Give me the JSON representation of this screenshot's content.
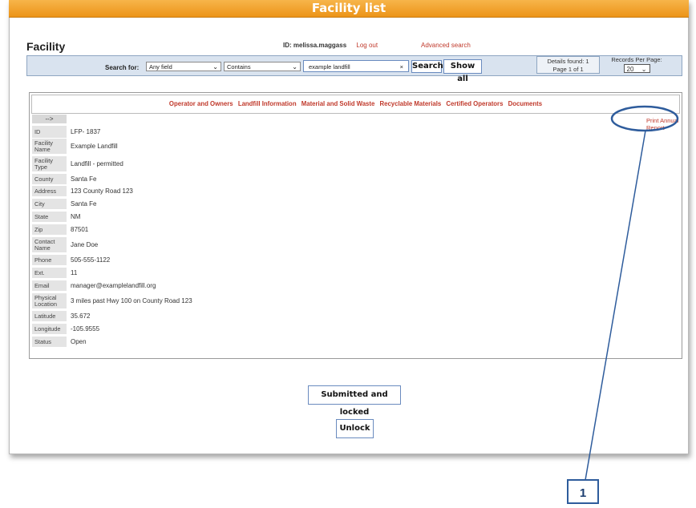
{
  "window": {
    "title": "Facility list"
  },
  "header": {
    "heading": "Facility",
    "user_id": "ID: melissa.maggass",
    "logout": "Log out",
    "advanced_search": "Advanced search"
  },
  "search": {
    "label": "Search for:",
    "field_select": "Any field",
    "operator_select": "Contains",
    "query": "example landfill",
    "clear": "×",
    "search_button": "Search",
    "show_all_button": "Show all",
    "details_line1": "Details found: 1",
    "details_line2": "Page 1 of 1",
    "rpp_label": "Records Per Page:",
    "rpp_value": "20"
  },
  "tabs": [
    "Operator and Owners",
    "Landfill Information",
    "Material and Solid Waste",
    "Recyclable Materials",
    "Certified Operators",
    "Documents"
  ],
  "record": {
    "arrow": "-->",
    "print_link": "Print Annual Report",
    "fields": [
      {
        "label": "ID",
        "value": "LFP- 1837"
      },
      {
        "label": "Facility Name",
        "value": "Example Landfill"
      },
      {
        "label": "Facility Type",
        "value": "Landfill - permitted"
      },
      {
        "label": "County",
        "value": "Santa Fe"
      },
      {
        "label": "Address",
        "value": "123 County Road 123"
      },
      {
        "label": "City",
        "value": "Santa Fe"
      },
      {
        "label": "State",
        "value": "NM"
      },
      {
        "label": "Zip",
        "value": "87501"
      },
      {
        "label": "Contact Name",
        "value": "Jane Doe"
      },
      {
        "label": "Phone",
        "value": "505-555-1122"
      },
      {
        "label": "Ext.",
        "value": "11"
      },
      {
        "label": "Email",
        "value": "manager@examplelandfill.org"
      },
      {
        "label": "Physical Location",
        "value": "3 miles past Hwy 100 on County Road 123"
      },
      {
        "label": "Latitude",
        "value": "35.672"
      },
      {
        "label": "Longitude",
        "value": "-105.9555"
      },
      {
        "label": "Status",
        "value": "Open"
      }
    ]
  },
  "actions": {
    "submitted_button": "Submitted and locked",
    "unlock_button": "Unlock"
  },
  "callout": {
    "number": "1"
  },
  "colors": {
    "title_bar": "#ec9418",
    "link": "#c0392b",
    "callout": "#2e5c9c"
  }
}
